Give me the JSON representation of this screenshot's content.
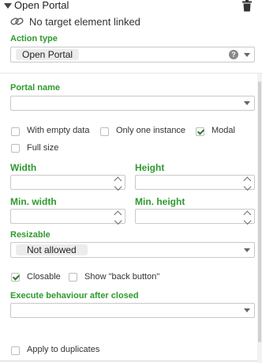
{
  "header": {
    "title": "Open Portal",
    "collapse_icon": "caret-down-icon",
    "delete_icon": "trash-icon"
  },
  "target": {
    "icon": "link-icon",
    "text": "No target element linked"
  },
  "action_type": {
    "label": "Action type",
    "value": "Open Portal",
    "help_icon": "question-icon"
  },
  "portal_name": {
    "label": "Portal name",
    "value": ""
  },
  "options": {
    "with_empty_data": {
      "label": "With empty data",
      "checked": false
    },
    "only_one_instance": {
      "label": "Only one instance",
      "checked": false
    },
    "modal": {
      "label": "Modal",
      "checked": true
    },
    "full_size": {
      "label": "Full size",
      "checked": false
    }
  },
  "dimensions": {
    "width_label": "Width",
    "height_label": "Height",
    "min_width_label": "Min. width",
    "min_height_label": "Min. height"
  },
  "resizable": {
    "label": "Resizable",
    "value": "Not allowed"
  },
  "closable": {
    "label": "Closable",
    "checked": true
  },
  "show_back_button": {
    "label": "Show \"back button\"",
    "checked": false
  },
  "execute_after": {
    "label": "Execute behaviour after closed",
    "value": ""
  },
  "apply_duplicates": {
    "label": "Apply to duplicates",
    "checked": false
  },
  "colors": {
    "accent_green": "#2e9a2e",
    "check_green": "#2a7a2a",
    "border": "#c9c9c9"
  }
}
